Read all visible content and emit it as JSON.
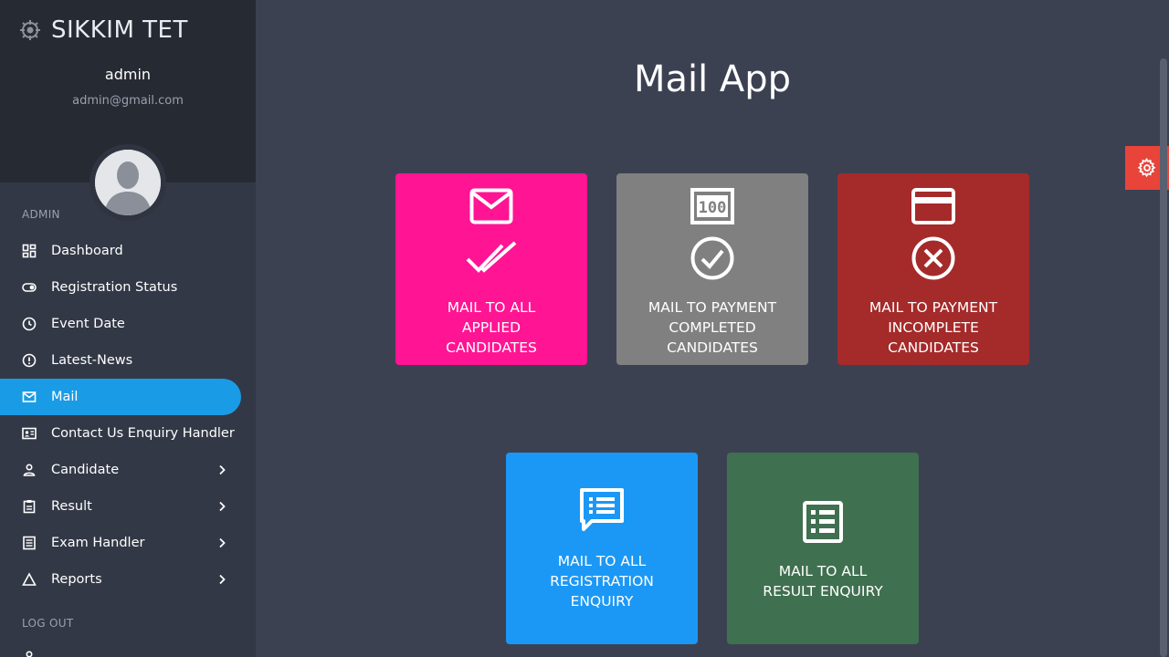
{
  "brand": {
    "title": "SIKKIM TET"
  },
  "user": {
    "name": "admin",
    "email": "admin@gmail.com"
  },
  "sidebar": {
    "section_admin": "ADMIN",
    "items": [
      {
        "label": "Dashboard",
        "icon": "dashboard-icon"
      },
      {
        "label": "Registration Status",
        "icon": "toggle-icon"
      },
      {
        "label": "Event Date",
        "icon": "clock-icon"
      },
      {
        "label": "Latest-News",
        "icon": "news-alert-icon"
      },
      {
        "label": "Mail",
        "icon": "mail-icon",
        "active": true
      },
      {
        "label": "Contact Us Enquiry Handler",
        "icon": "contact-card-icon"
      },
      {
        "label": "Candidate",
        "icon": "person-icon"
      },
      {
        "label": "Result",
        "icon": "clipboard-icon"
      },
      {
        "label": "Exam Handler",
        "icon": "list-icon"
      },
      {
        "label": "Reports",
        "icon": "triangle-icon"
      }
    ],
    "section_logout": "LOG OUT"
  },
  "main": {
    "title": "Mail App",
    "tiles": [
      {
        "label_lines": [
          "MAIL TO ALL",
          "APPLIED",
          "CANDIDATES"
        ],
        "color": "#ff1493",
        "icon": "mail-double-check-icon"
      },
      {
        "label_lines": [
          "MAIL TO PAYMENT",
          "COMPLETED",
          "CANDIDATES"
        ],
        "color": "#808080",
        "icon": "counter-check-icon"
      },
      {
        "label_lines": [
          "MAIL TO PAYMENT",
          "INCOMPLETE",
          "CANDIDATES"
        ],
        "color": "#a52a2a",
        "icon": "card-cancel-icon"
      },
      {
        "label_lines": [
          "MAIL TO ALL",
          "REGISTRATION",
          "ENQUIRY"
        ],
        "color": "#1b98f5",
        "icon": "chat-list-icon"
      },
      {
        "label_lines": [
          "MAIL TO ALL",
          "RESULT ENQUIRY"
        ],
        "color": "#3f7050",
        "icon": "document-list-icon"
      }
    ]
  },
  "colors": {
    "accent": "#1a9be6",
    "settings": "#e8443a"
  }
}
